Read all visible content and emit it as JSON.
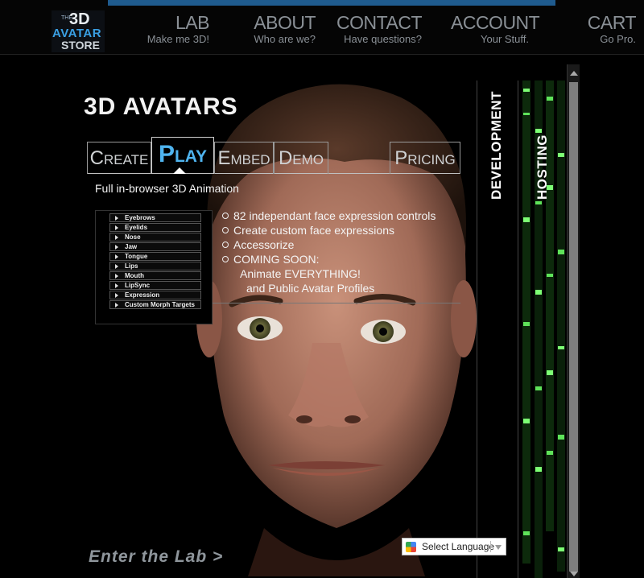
{
  "header": {
    "logo": {
      "line1": "THE",
      "line2": "3D",
      "line3": "AVATAR",
      "line4": "STORE"
    },
    "nav": [
      {
        "title": "LAB",
        "subtitle": "Make me 3D!"
      },
      {
        "title": "ABOUT",
        "subtitle": "Who are we?"
      },
      {
        "title": "CONTACT",
        "subtitle": "Have questions?"
      },
      {
        "title": "ACCOUNT",
        "subtitle": "Your Stuff."
      },
      {
        "title": "CART",
        "subtitle": "Go Pro."
      }
    ]
  },
  "main": {
    "title": "3D AVATARS",
    "tabs": [
      {
        "label": "Create"
      },
      {
        "label": "Play"
      },
      {
        "label": "Embed"
      },
      {
        "label": "Demo"
      },
      {
        "label": "Pricing"
      }
    ],
    "active_tab": "Play",
    "subtitle": "Full in-browser 3D Animation",
    "morph_menu": [
      "Eyebrows",
      "Eyelids",
      "Nose",
      "Jaw",
      "Tongue",
      "Lips",
      "Mouth",
      "LipSync",
      "Expression",
      "Custom Morph Targets"
    ],
    "features": [
      "82 independant face expression controls",
      "Create custom face expressions",
      "Accessorize",
      "COMING SOON:"
    ],
    "coming_soon_1": "Animate EVERYTHING!",
    "coming_soon_2": "and Public Avatar Profiles",
    "enter_lab": "Enter the Lab >"
  },
  "sidebar": {
    "development": "DEVELOPMENT",
    "hosting": "HOSTING"
  },
  "language": {
    "label": "Select Language"
  },
  "colors": {
    "accent": "#4fb4ef",
    "nav_text": "#8a9096",
    "topbar_accent": "#1f5b8e"
  }
}
